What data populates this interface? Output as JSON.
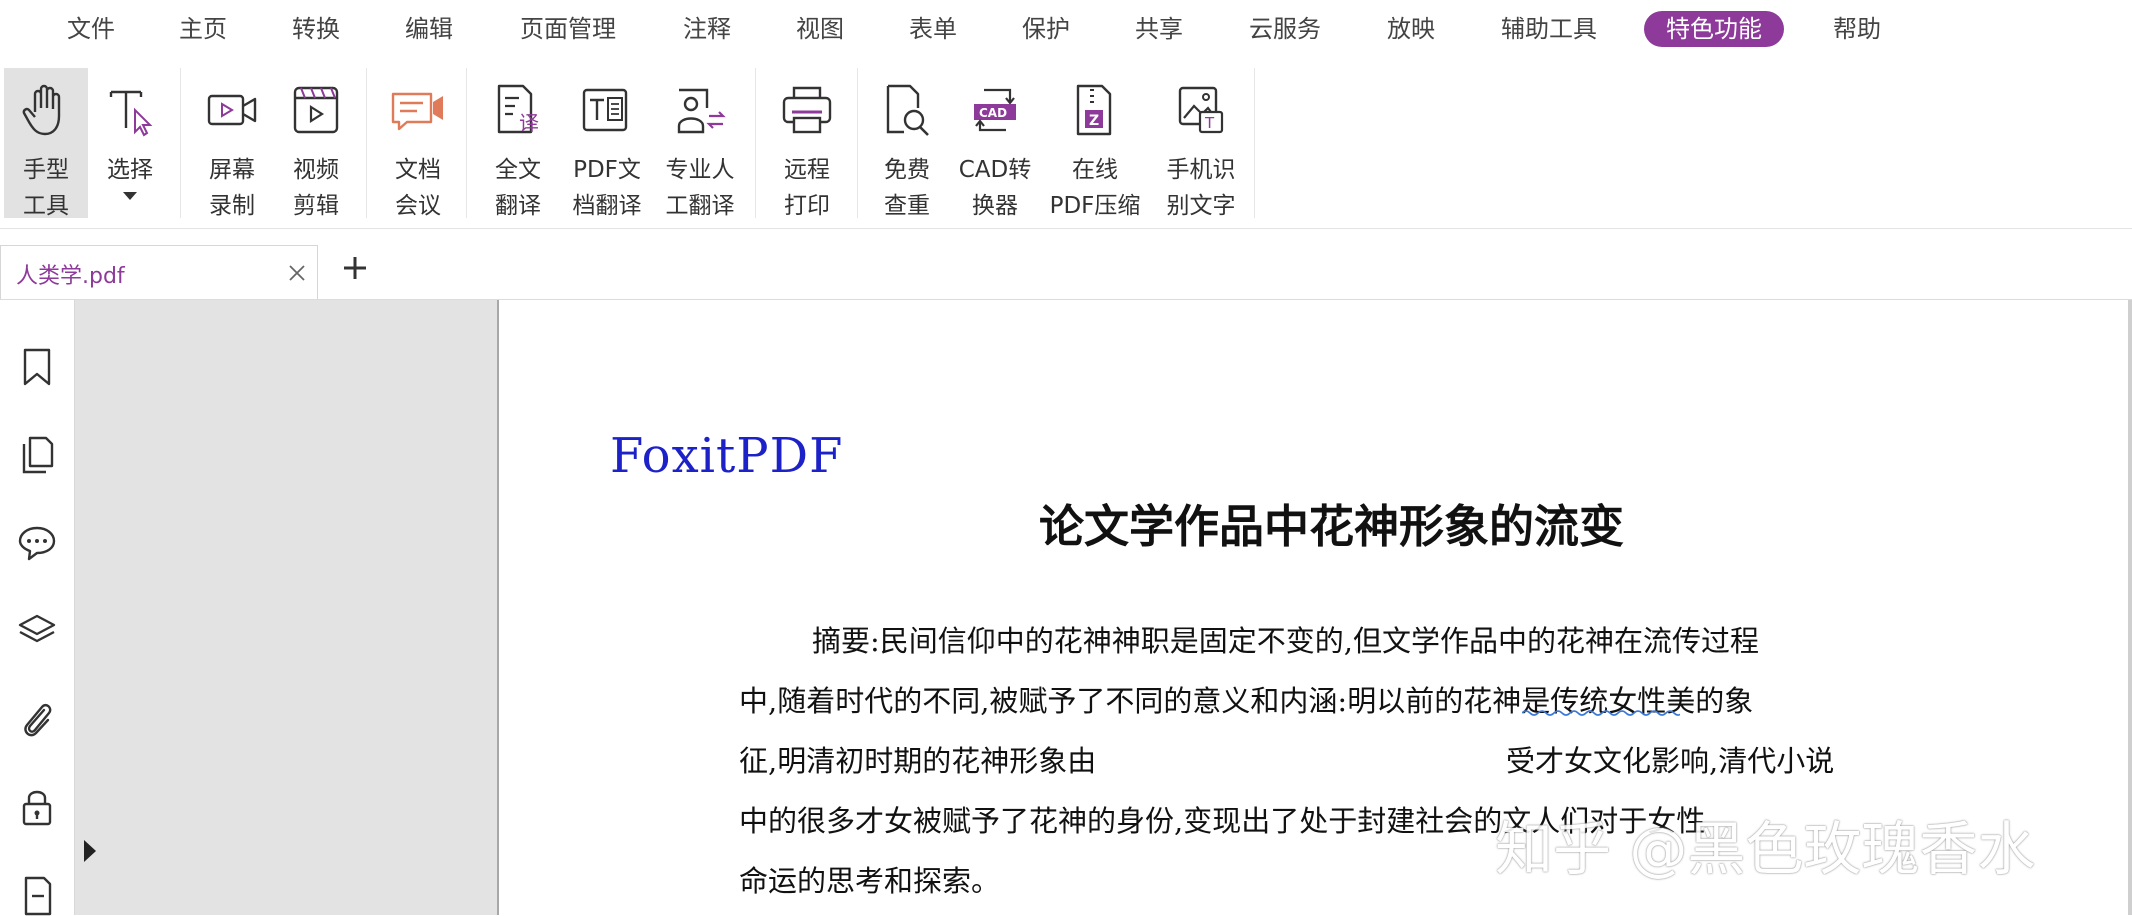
{
  "menu": {
    "items": [
      {
        "label": "文件",
        "active": false
      },
      {
        "label": "主页",
        "active": false
      },
      {
        "label": "转换",
        "active": false
      },
      {
        "label": "编辑",
        "active": false
      },
      {
        "label": "页面管理",
        "active": false
      },
      {
        "label": "注释",
        "active": false
      },
      {
        "label": "视图",
        "active": false
      },
      {
        "label": "表单",
        "active": false
      },
      {
        "label": "保护",
        "active": false
      },
      {
        "label": "共享",
        "active": false
      },
      {
        "label": "云服务",
        "active": false
      },
      {
        "label": "放映",
        "active": false
      },
      {
        "label": "辅助工具",
        "active": false
      },
      {
        "label": "特色功能",
        "active": true
      },
      {
        "label": "帮助",
        "active": false
      }
    ]
  },
  "ribbon": {
    "tools": [
      {
        "label": "手型\n工具",
        "icon": "hand-icon",
        "selected": true
      },
      {
        "label": "选择",
        "icon": "select-text-icon",
        "has_dropdown": true
      },
      {
        "label": "屏幕\n录制",
        "icon": "screen-record-icon"
      },
      {
        "label": "视频\n剪辑",
        "icon": "video-edit-icon"
      },
      {
        "label": "文档\n会议",
        "icon": "doc-meeting-icon"
      },
      {
        "label": "全文\n翻译",
        "icon": "full-translate-icon"
      },
      {
        "label": "PDF文\n档翻译",
        "icon": "pdf-translate-icon"
      },
      {
        "label": "专业人\n工翻译",
        "icon": "human-translate-icon"
      },
      {
        "label": "远程\n打印",
        "icon": "remote-print-icon"
      },
      {
        "label": "免费\n查重",
        "icon": "plagiarism-check-icon"
      },
      {
        "label": "CAD转\n换器",
        "icon": "cad-converter-icon"
      },
      {
        "label": "在线\nPDF压缩",
        "icon": "pdf-compress-icon"
      },
      {
        "label": "手机识\n别文字",
        "icon": "mobile-ocr-icon"
      }
    ]
  },
  "tabs": {
    "document_title": "人类学.pdf",
    "close_icon": "close-icon",
    "new_tab_icon": "plus-icon"
  },
  "sidebar": {
    "icons": [
      "bookmark-icon",
      "pages-icon",
      "comments-icon",
      "layers-icon",
      "attachments-icon",
      "security-icon",
      "signature-icon"
    ]
  },
  "document": {
    "brand": "FoxitPDF",
    "title": "论文学作品中花神形象的流变",
    "abstract_lines": [
      "摘要:民间信仰中的花神神职是固定不变的,但文学作品中的花神在流传过程",
      "中,随着时代的不同,被赋予了不同的意义和内涵:明以前的花神是传统女性美的象",
      "征,明清初时期的花神形象由",
      "受才女文化影响,清代小说",
      "中的很多才女被赋予了花神的身份,变现出了处于封建社会的文人们对于女性",
      "命运的思考和探索。"
    ]
  },
  "watermark": "知乎 @黑色玫瑰香水",
  "colors": {
    "accent": "#8e3a9a",
    "brand_blue": "#1c22c8",
    "nav_pane": "#e3e3e3"
  }
}
